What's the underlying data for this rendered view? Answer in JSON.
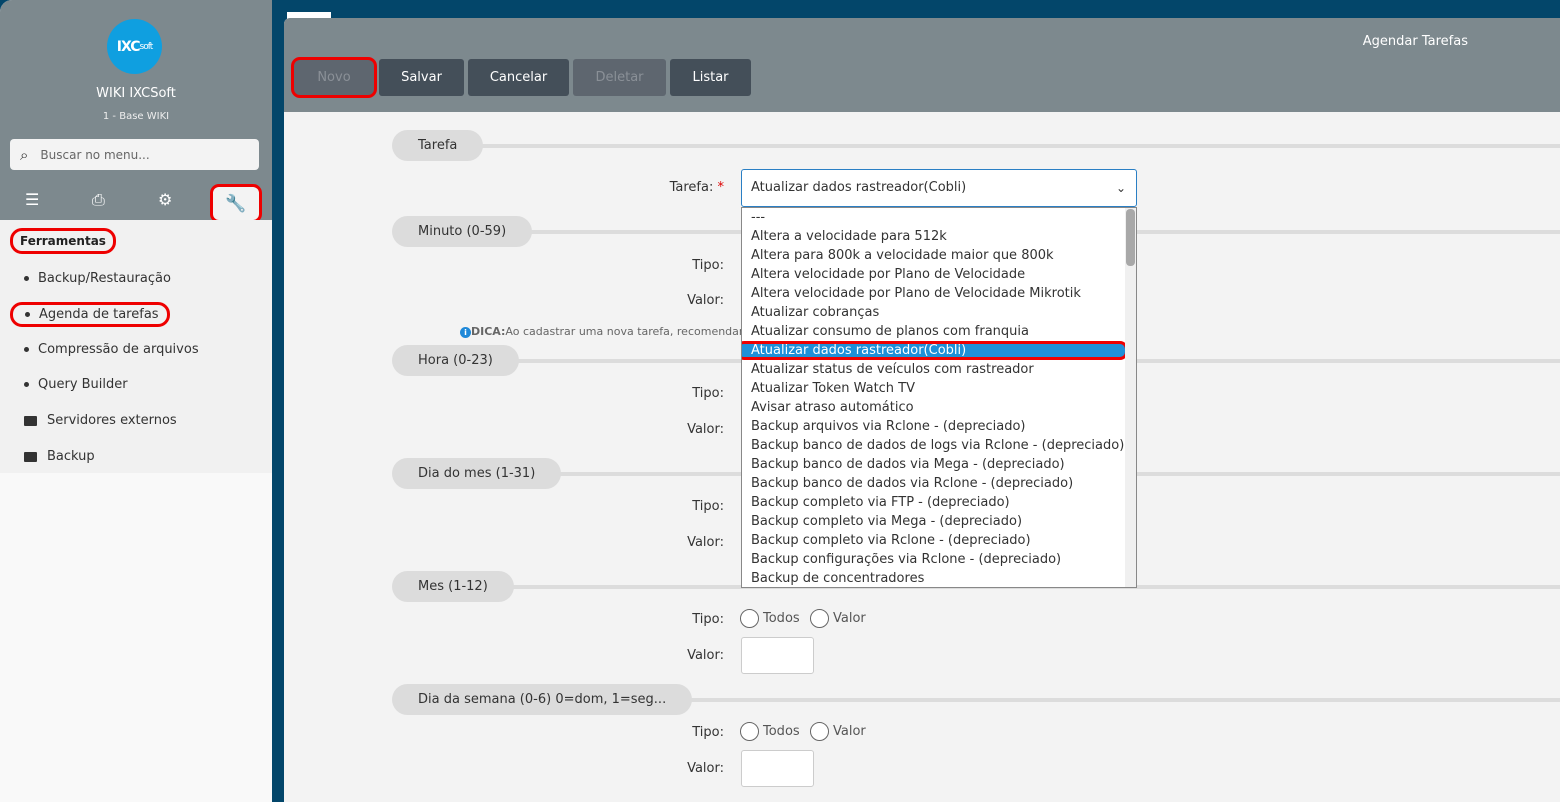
{
  "sidebar": {
    "logo": "IXCsoft",
    "title": "WIKI IXCSoft",
    "subtitle": "1 - Base WIKI",
    "search_placeholder": "Buscar no menu...",
    "tab_icons": [
      "list-icon",
      "printer-icon",
      "gears-icon",
      "wrench-icon"
    ],
    "section": "Ferramentas",
    "items": [
      {
        "label": "Backup/Restauração",
        "type": "bullet"
      },
      {
        "label": "Agenda de tarefas",
        "type": "bullet"
      },
      {
        "label": "Compressão de arquivos",
        "type": "bullet"
      },
      {
        "label": "Query Builder",
        "type": "bullet"
      },
      {
        "label": "Servidores externos",
        "type": "folder"
      },
      {
        "label": "Backup",
        "type": "folder"
      }
    ]
  },
  "header": {
    "title": "Agendar Tarefas",
    "buttons": {
      "novo": "Novo",
      "salvar": "Salvar",
      "cancelar": "Cancelar",
      "deletar": "Deletar",
      "listar": "Listar"
    }
  },
  "form": {
    "sections": {
      "tarefa": "Tarefa",
      "minuto": "Minuto (0-59)",
      "hora": "Hora (0-23)",
      "dia_mes": "Dia do mes (1-31)",
      "mes": "Mes (1-12)",
      "dia_semana": "Dia da semana (0-6) 0=dom, 1=seg..."
    },
    "labels": {
      "tarefa": "Tarefa:",
      "required": "*",
      "tipo": "Tipo:",
      "valor": "Valor:",
      "todos": "Todos",
      "valor_opt": "Valor"
    },
    "tarefa_value": "Atualizar dados rastreador(Cobli)",
    "dica_label": "DICA:",
    "dica_text": "Ao cadastrar uma nova tarefa, recomendamos",
    "options": [
      "---",
      "Altera a velocidade para 512k",
      "Altera para 800k a velocidade maior que 800k",
      "Altera velocidade por Plano de Velocidade",
      "Altera velocidade por Plano de Velocidade Mikrotik",
      "Atualizar cobranças",
      "Atualizar consumo de planos com franquia",
      "Atualizar dados rastreador(Cobli)",
      "Atualizar status de veículos com rastreador",
      "Atualizar Token Watch TV",
      "Avisar atraso automático",
      "Backup arquivos via Rclone - (depreciado)",
      "Backup banco de dados de logs via Rclone - (depreciado)",
      "Backup banco de dados via Mega - (depreciado)",
      "Backup banco de dados via Rclone - (depreciado)",
      "Backup completo via FTP - (depreciado)",
      "Backup completo via Mega - (depreciado)",
      "Backup completo via Rclone - (depreciado)",
      "Backup configurações via Rclone - (depreciado)",
      "Backup de concentradores"
    ],
    "selected_index": 7
  }
}
